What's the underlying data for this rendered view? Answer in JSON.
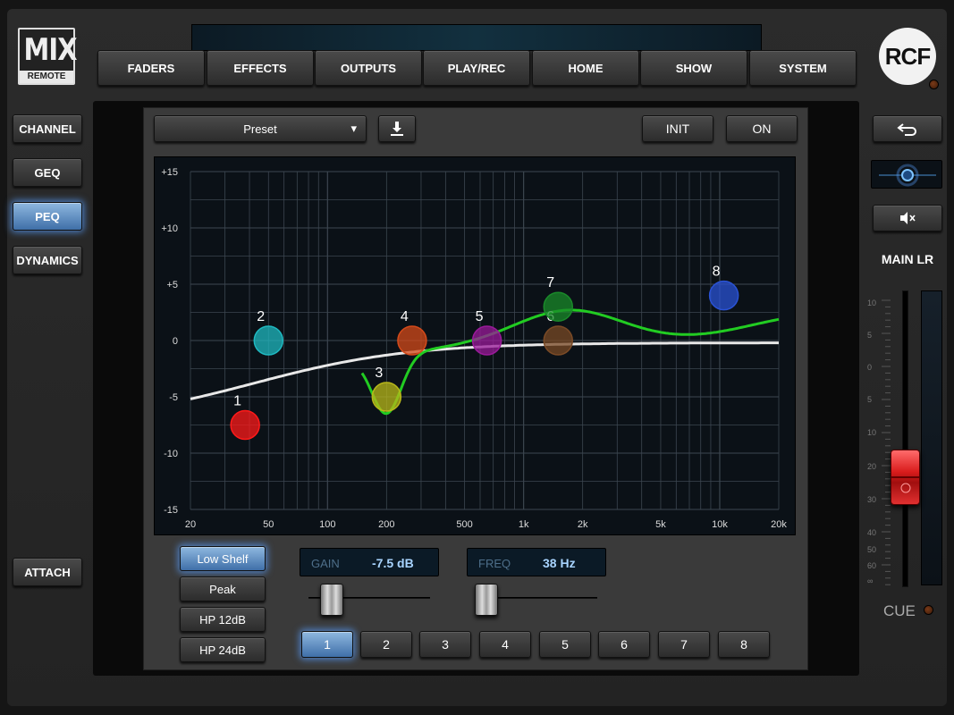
{
  "logo": {
    "mix_text": "MIX",
    "remote_text": "REMOTE",
    "brand": "RCF"
  },
  "top_nav": [
    {
      "id": "faders",
      "label": "FADERS"
    },
    {
      "id": "effects",
      "label": "EFFECTS"
    },
    {
      "id": "outputs",
      "label": "OUTPUTS"
    },
    {
      "id": "playrec",
      "label": "PLAY/REC"
    },
    {
      "id": "home",
      "label": "HOME"
    },
    {
      "id": "show",
      "label": "SHOW"
    },
    {
      "id": "system",
      "label": "SYSTEM"
    }
  ],
  "left_nav": {
    "channel": "CHANNEL",
    "geq": "GEQ",
    "peq": "PEQ",
    "dynamics": "DYNAMICS",
    "attach": "ATTACH",
    "active": "PEQ"
  },
  "peq": {
    "preset_label": "Preset",
    "preset_arrow": "▾",
    "save_icon": "download-icon",
    "init_label": "INIT",
    "on_label": "ON",
    "graph": {
      "y_ticks": [
        "+15",
        "+10",
        "+5",
        "0",
        "-5",
        "-10",
        "-15"
      ],
      "x_ticks": [
        "20",
        "50",
        "100",
        "200",
        "500",
        "1k",
        "2k",
        "5k",
        "10k",
        "20k"
      ],
      "bands": [
        {
          "num": "1",
          "freq": 38,
          "gain": -7.5,
          "color": "#ff1a1a"
        },
        {
          "num": "2",
          "freq": 50,
          "gain": 0,
          "color": "#1fb8c0"
        },
        {
          "num": "3",
          "freq": 200,
          "gain": -5,
          "color": "#b8b81a"
        },
        {
          "num": "4",
          "freq": 270,
          "gain": 0,
          "color": "#d44a1a"
        },
        {
          "num": "5",
          "freq": 650,
          "gain": 0,
          "color": "#9a1a9a"
        },
        {
          "num": "6",
          "freq": 1500,
          "gain": 0,
          "color": "#7a4a26"
        },
        {
          "num": "7",
          "freq": 1500,
          "gain": 3,
          "color": "#1a8a2a"
        },
        {
          "num": "8",
          "freq": 10500,
          "gain": 4,
          "color": "#2a52d4"
        }
      ]
    },
    "filter_types": [
      "Low Shelf",
      "Peak",
      "HP 12dB",
      "HP 24dB"
    ],
    "filter_active": "Low Shelf",
    "gain_label": "GAIN",
    "gain_value": "-7.5 dB",
    "freq_label": "FREQ",
    "freq_value": "38 Hz",
    "band_buttons": [
      "1",
      "2",
      "3",
      "4",
      "5",
      "6",
      "7",
      "8"
    ],
    "band_active": "1"
  },
  "right_panel": {
    "back_icon": "back-arrow-icon",
    "pan_icon": "pan-knob-icon",
    "mute_icon": "speaker-mute-icon",
    "channel_name": "MAIN LR",
    "scale": [
      "10",
      "5",
      "0",
      "5",
      "10",
      "20",
      "30",
      "40",
      "50",
      "60",
      "∞"
    ],
    "cue_label": "CUE"
  },
  "colors": {
    "active_blue": "#5a9be0",
    "eq_curve": "#22cc22",
    "fader_red": "#d91c1c"
  }
}
